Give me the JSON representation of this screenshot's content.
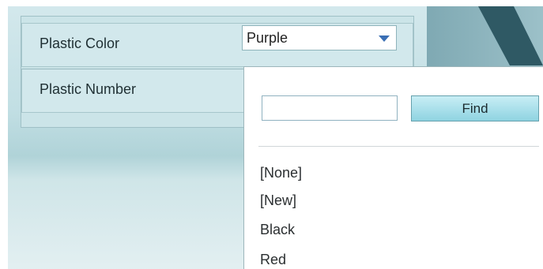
{
  "form": {
    "plastic_color_label": "Plastic Color",
    "plastic_number_label": "Plastic Number",
    "plastic_color_value": "Purple"
  },
  "dropdown": {
    "search_value": "",
    "find_label": "Find",
    "options": [
      "[None]",
      "[New]",
      "Black",
      "Red"
    ]
  },
  "colors": {
    "background": "#c2dfe4",
    "dark_panel": "#2f5964",
    "arrow": "#3a6fb4",
    "find_button": "#8fd3e1"
  }
}
